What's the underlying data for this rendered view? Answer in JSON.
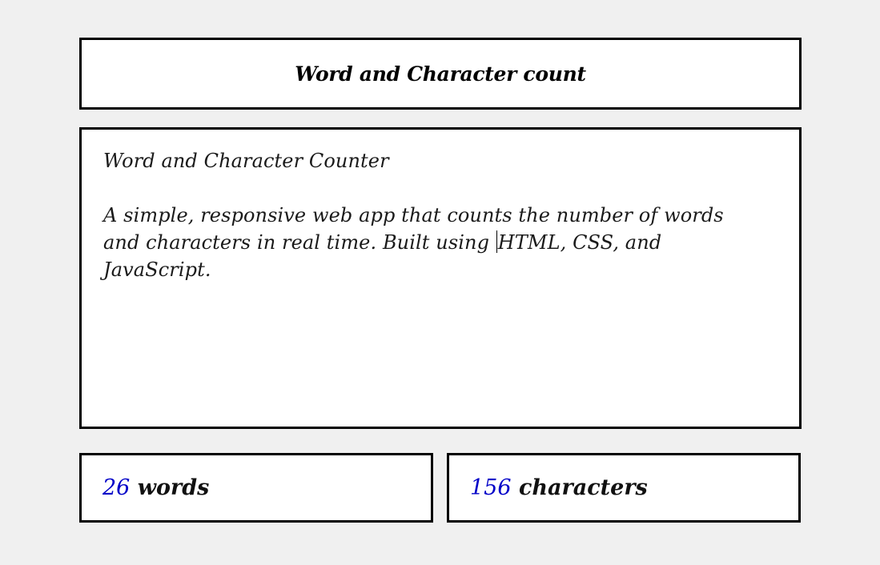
{
  "header": {
    "title": "Word and Character count"
  },
  "editor": {
    "line1": "Word and Character Counter",
    "line2_before_caret": "A simple, responsive web app that counts the number of words and characters in real time. Built using ",
    "line2_after_caret": "HTML, CSS, and JavaScript."
  },
  "stats": {
    "words": {
      "count": "26",
      "label": " words"
    },
    "characters": {
      "count": "156",
      "label": " characters"
    }
  },
  "colors": {
    "count_color": "#0000c8",
    "border": "#000000",
    "background": "#f0f0f0"
  }
}
